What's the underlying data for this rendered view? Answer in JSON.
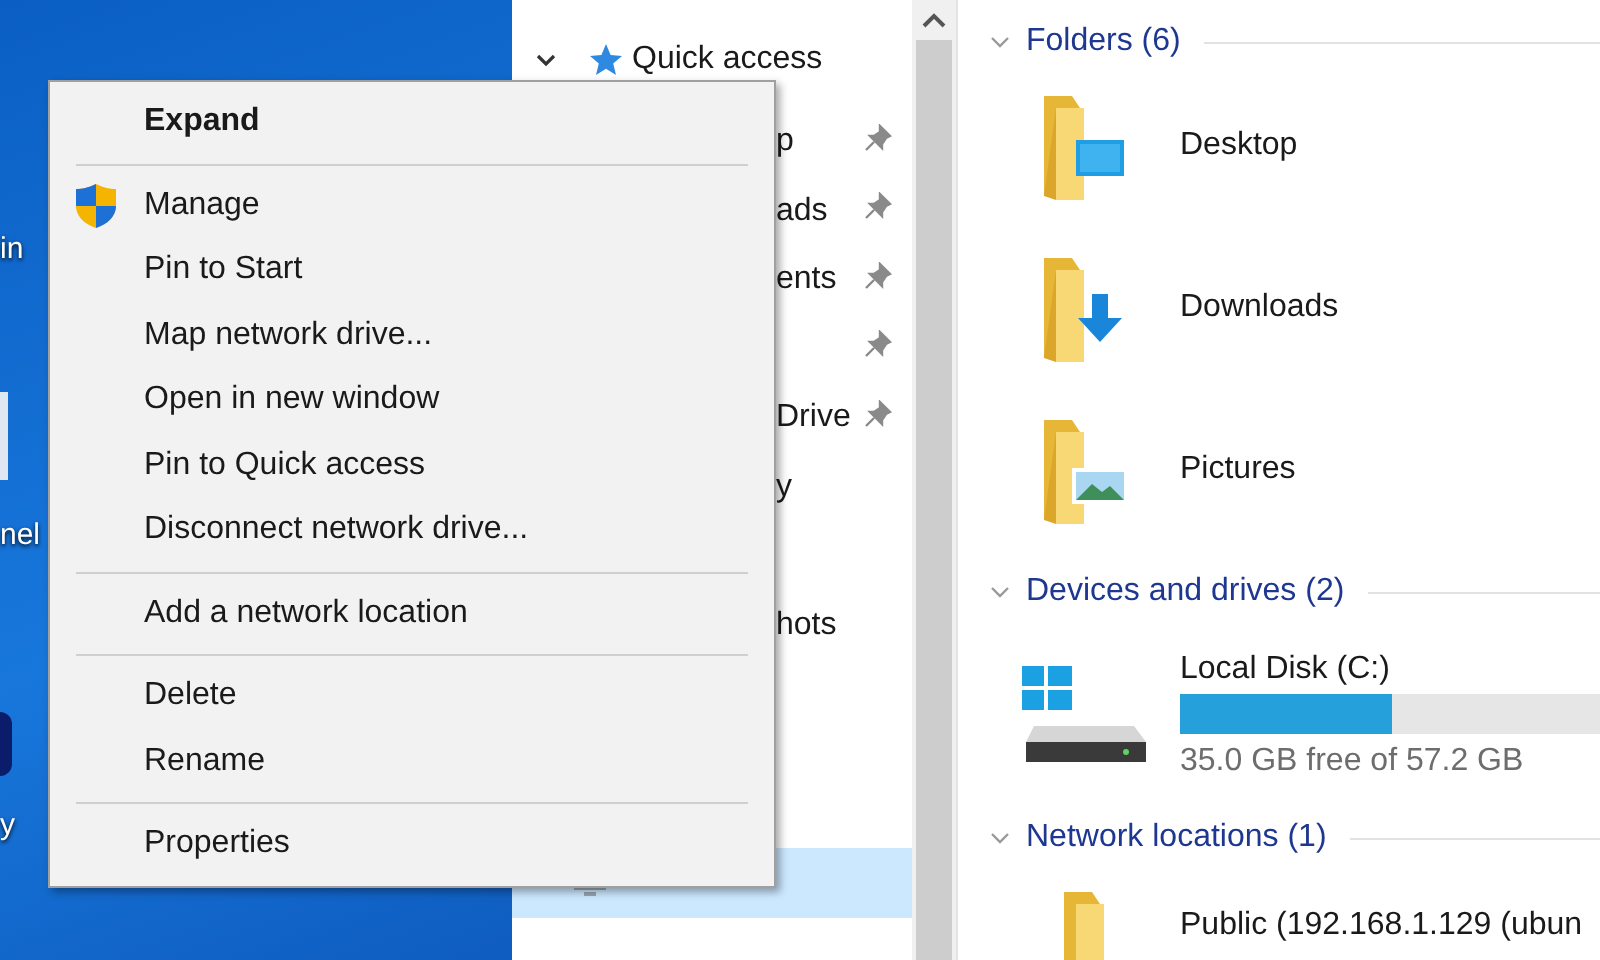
{
  "desktop": {
    "icon_labels": [
      "in",
      "nel",
      "y"
    ]
  },
  "navigation": {
    "quick_access": {
      "label": "Quick access",
      "expanded": true
    },
    "items": [
      {
        "label": "p",
        "pinned": true,
        "selected": false
      },
      {
        "label": "ads",
        "pinned": true,
        "selected": false
      },
      {
        "label": "ents",
        "pinned": true,
        "selected": false
      },
      {
        "pinned": true,
        "selected": false
      },
      {
        "label": "Drive",
        "pinned": true,
        "selected": false
      },
      {
        "label": "y",
        "pinned": false,
        "selected": false
      },
      {
        "label": "hots",
        "pinned": false,
        "selected": false
      },
      {
        "pinned": false,
        "selected": true
      }
    ]
  },
  "content": {
    "groups": [
      {
        "title": "Folders (6)",
        "expanded": true,
        "items": [
          {
            "kind": "folder",
            "name": "Desktop"
          },
          {
            "kind": "folder",
            "name": "Downloads"
          },
          {
            "kind": "folder",
            "name": "Pictures"
          }
        ]
      },
      {
        "title": "Devices and drives (2)",
        "expanded": true,
        "items": [
          {
            "kind": "drive",
            "name": "Local Disk (C:)",
            "level": 0.39,
            "free": "35.0 GB free of 57.2 GB"
          }
        ]
      },
      {
        "title": "Network locations (1)",
        "expanded": true,
        "items": [
          {
            "kind": "network",
            "name": "Public (192.168.1.129 (ubun"
          }
        ]
      }
    ]
  },
  "context_menu": {
    "items": [
      {
        "kind": "item",
        "label": "Expand",
        "default": true,
        "elevated": false
      },
      {
        "kind": "separator"
      },
      {
        "kind": "item",
        "label": "Manage",
        "default": false,
        "elevated": true
      },
      {
        "kind": "item",
        "label": "Pin to Start",
        "default": false,
        "elevated": false
      },
      {
        "kind": "item",
        "label": "Map network drive...",
        "default": false,
        "elevated": false
      },
      {
        "kind": "item",
        "label": "Open in new window",
        "default": false,
        "elevated": false
      },
      {
        "kind": "item",
        "label": "Pin to Quick access",
        "default": false,
        "elevated": false
      },
      {
        "kind": "item",
        "label": "Disconnect network drive...",
        "default": false,
        "elevated": false
      },
      {
        "kind": "separator"
      },
      {
        "kind": "item",
        "label": "Add a network location",
        "default": false,
        "elevated": false
      },
      {
        "kind": "separator"
      },
      {
        "kind": "item",
        "label": "Delete",
        "default": false,
        "elevated": false
      },
      {
        "kind": "item",
        "label": "Rename",
        "default": false,
        "elevated": false
      },
      {
        "kind": "separator"
      },
      {
        "kind": "item",
        "label": "Properties",
        "default": false,
        "elevated": false
      }
    ]
  }
}
